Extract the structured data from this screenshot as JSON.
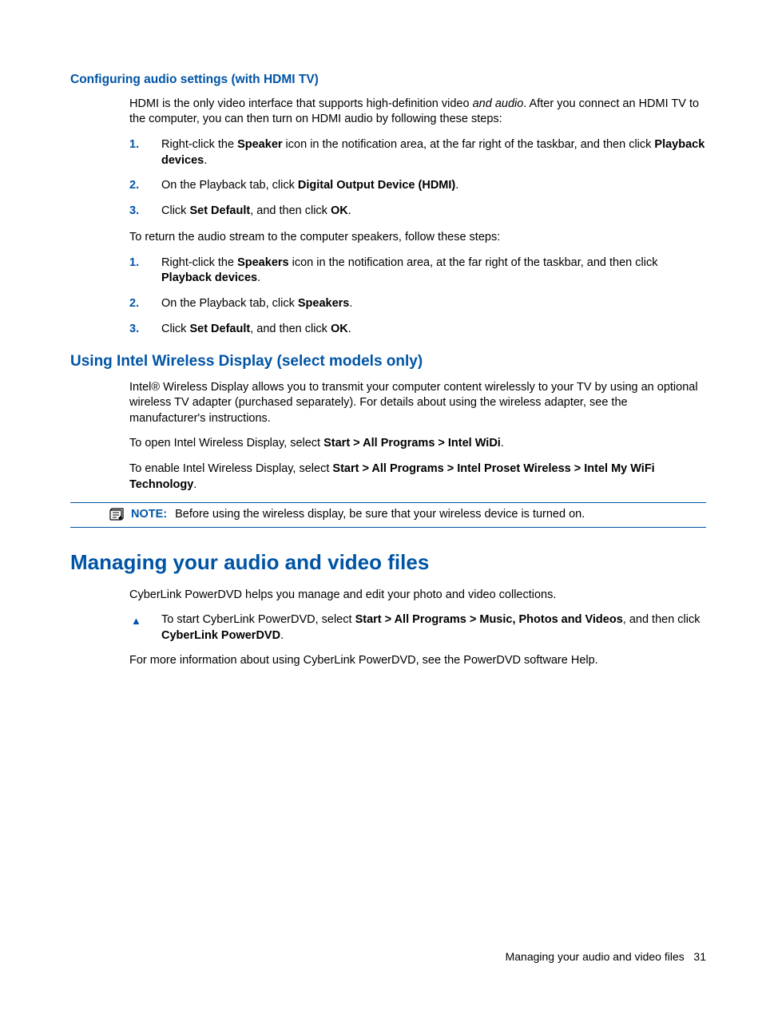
{
  "section1": {
    "heading": "Configuring audio settings (with HDMI TV)",
    "intro_prefix": "HDMI is the only video interface that supports high-definition video ",
    "intro_italic": "and audio",
    "intro_suffix": ". After you connect an HDMI TV to the computer, you can then turn on HDMI audio by following these steps:",
    "listA": [
      {
        "num": "1.",
        "pre": "Right-click the ",
        "b1": "Speaker",
        "mid": " icon in the notification area, at the far right of the taskbar, and then click ",
        "b2": "Playback devices",
        "post": "."
      },
      {
        "num": "2.",
        "pre": "On the Playback tab, click ",
        "b1": "Digital Output Device (HDMI)",
        "mid": "",
        "b2": "",
        "post": "."
      },
      {
        "num": "3.",
        "pre": "Click ",
        "b1": "Set Default",
        "mid": ", and then click ",
        "b2": "OK",
        "post": "."
      }
    ],
    "returnText": "To return the audio stream to the computer speakers, follow these steps:",
    "listB": [
      {
        "num": "1.",
        "pre": "Right-click the ",
        "b1": "Speakers",
        "mid": " icon in the notification area, at the far right of the taskbar, and then click ",
        "b2": "Playback devices",
        "post": "."
      },
      {
        "num": "2.",
        "pre": "On the Playback tab, click ",
        "b1": "Speakers",
        "mid": "",
        "b2": "",
        "post": "."
      },
      {
        "num": "3.",
        "pre": "Click ",
        "b1": "Set Default",
        "mid": ", and then click ",
        "b2": "OK",
        "post": "."
      }
    ]
  },
  "section2": {
    "heading": "Using Intel Wireless Display (select models only)",
    "p1": "Intel® Wireless Display allows you to transmit your computer content wirelessly to your TV by using an optional wireless TV adapter (purchased separately). For details about using the wireless adapter, see the manufacturer's instructions.",
    "p2_pre": "To open Intel Wireless Display, select ",
    "p2_bold": "Start > All Programs > Intel WiDi",
    "p2_post": ".",
    "p3_pre": "To enable Intel Wireless Display, select ",
    "p3_bold": "Start > All Programs > Intel Proset Wireless > Intel My WiFi Technology",
    "p3_post": ".",
    "noteLabel": "NOTE:",
    "noteText": "Before using the wireless display, be sure that your wireless device is turned on."
  },
  "section3": {
    "heading": "Managing your audio and video files",
    "p1": "CyberLink PowerDVD helps you manage and edit your photo and video collections.",
    "bullet_pre": "To start CyberLink PowerDVD, select ",
    "bullet_bold": "Start > All Programs > Music, Photos and Videos",
    "bullet_mid": ", and then click ",
    "bullet_bold2": "CyberLink PowerDVD",
    "bullet_post": ".",
    "p2": "For more information about using CyberLink PowerDVD, see the PowerDVD software Help."
  },
  "footer": {
    "title": "Managing your audio and video files",
    "page": "31"
  }
}
